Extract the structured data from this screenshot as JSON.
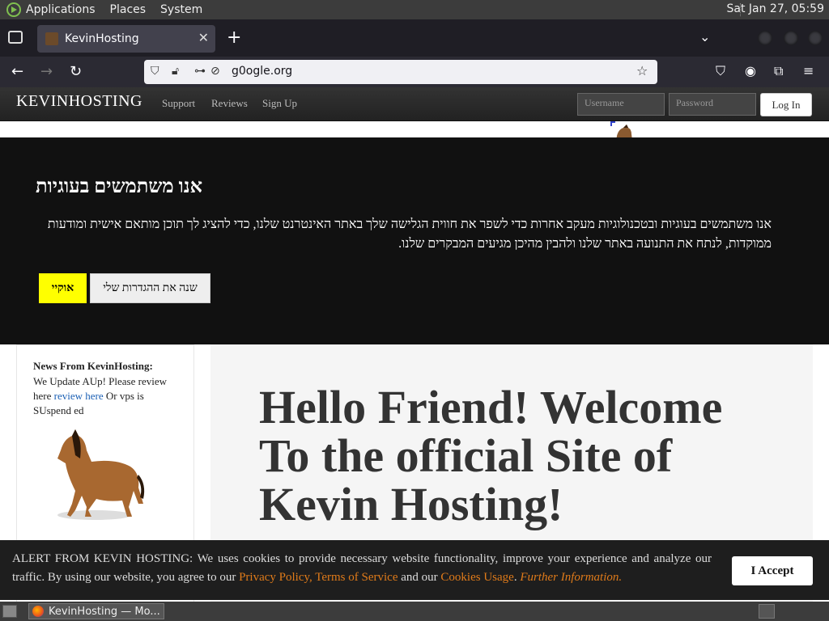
{
  "system_bar": {
    "menus": [
      "Applications",
      "Places",
      "System"
    ],
    "clock": "Sat Jan 27, 05:59"
  },
  "browser": {
    "tab_title": "KevinHosting",
    "url": "g0ogle.org"
  },
  "site": {
    "brand": "KEVINHOSTING",
    "nav": [
      "Support",
      "Reviews",
      "Sign Up"
    ],
    "username_placeholder": "Username",
    "password_placeholder": "Password",
    "login_label": "Log In"
  },
  "cookie_block": {
    "title": "אנו משתמשים בעוגיות",
    "text": "אנו משתמשים בעוגיות ובטכנולוגיות מעקב אחרות כדי לשפר את חווית הגלישה שלך באתר האינטרנט שלנו, כדי להציג לך תוכן מותאם אישית ומודעות ממוקדות, לנתח את התנועה באתר שלנו ולהבין מהיכן מגיעים המבקרים שלנו.",
    "ok_label": "אוקיי",
    "settings_label": "שנה את ההגדרות שלי"
  },
  "sidebar": {
    "news_heading": "News From KevinHosting:",
    "news_prefix": "We Update AUp! Please review here ",
    "news_link": "review here",
    "news_suffix": " Or vps is SUspend ed"
  },
  "hero": {
    "headline": "Hello Friend! Welcome To the official Site of Kevin Hosting!"
  },
  "alert": {
    "prefix": "ALERT FROM KEVIN HOSTING: We uses cookies to provide necessary website functionality, improve your experience and analyze our traffic. By using our website, you agree to our ",
    "privacy": "Privacy Policy",
    "comma": ", ",
    "tos": "Terms of Service",
    "and": " and our ",
    "cookies": "Cookies Usage",
    "dot": ". ",
    "further": "Further Information.",
    "accept_label": "I Accept"
  },
  "taskbar": {
    "task_label": "KevinHosting — Mo..."
  }
}
